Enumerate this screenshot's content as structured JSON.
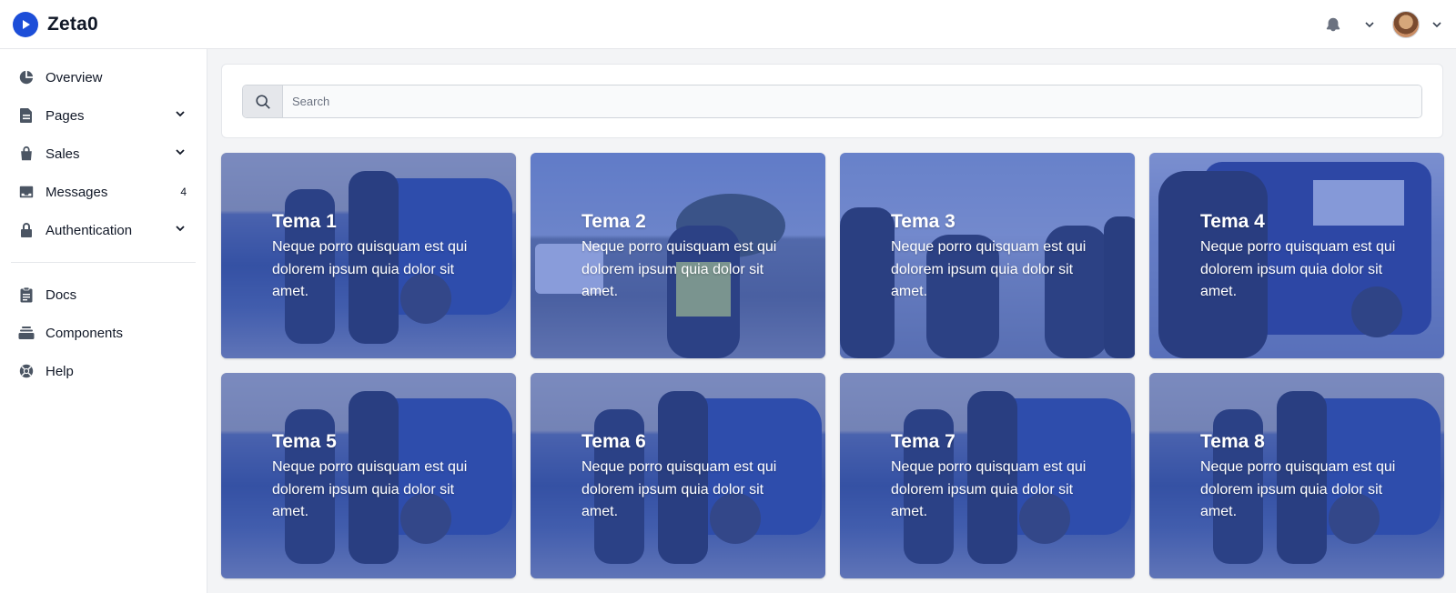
{
  "header": {
    "brand": "Zeta0",
    "accent": "#1d4ed8"
  },
  "sidebar": {
    "items": [
      {
        "label": "Overview",
        "icon": "chart-pie-icon",
        "chevron": false
      },
      {
        "label": "Pages",
        "icon": "document-icon",
        "chevron": true
      },
      {
        "label": "Sales",
        "icon": "shopping-bag-icon",
        "chevron": true
      },
      {
        "label": "Messages",
        "icon": "inbox-icon",
        "badge": "4"
      },
      {
        "label": "Authentication",
        "icon": "lock-icon",
        "chevron": true
      }
    ],
    "secondary": [
      {
        "label": "Docs",
        "icon": "clipboard-icon"
      },
      {
        "label": "Components",
        "icon": "collection-icon"
      },
      {
        "label": "Help",
        "icon": "support-icon"
      }
    ]
  },
  "search": {
    "placeholder": "Search",
    "icon": "search-icon"
  },
  "cards": [
    {
      "title": "Tema 1",
      "body": "Neque porro quisquam est qui dolorem ipsum quia dolor sit amet."
    },
    {
      "title": "Tema 2",
      "body": "Neque porro quisquam est qui dolorem ipsum quia dolor sit amet."
    },
    {
      "title": "Tema 3",
      "body": "Neque porro quisquam est qui dolorem ipsum quia dolor sit amet."
    },
    {
      "title": "Tema 4",
      "body": "Neque porro quisquam est qui dolorem ipsum quia dolor sit amet."
    },
    {
      "title": "Tema 5",
      "body": "Neque porro quisquam est qui dolorem ipsum quia dolor sit amet."
    },
    {
      "title": "Tema 6",
      "body": "Neque porro quisquam est qui dolorem ipsum quia dolor sit amet."
    },
    {
      "title": "Tema 7",
      "body": "Neque porro quisquam est qui dolorem ipsum quia dolor sit amet."
    },
    {
      "title": "Tema 8",
      "body": "Neque porro quisquam est qui dolorem ipsum quia dolor sit amet."
    }
  ]
}
